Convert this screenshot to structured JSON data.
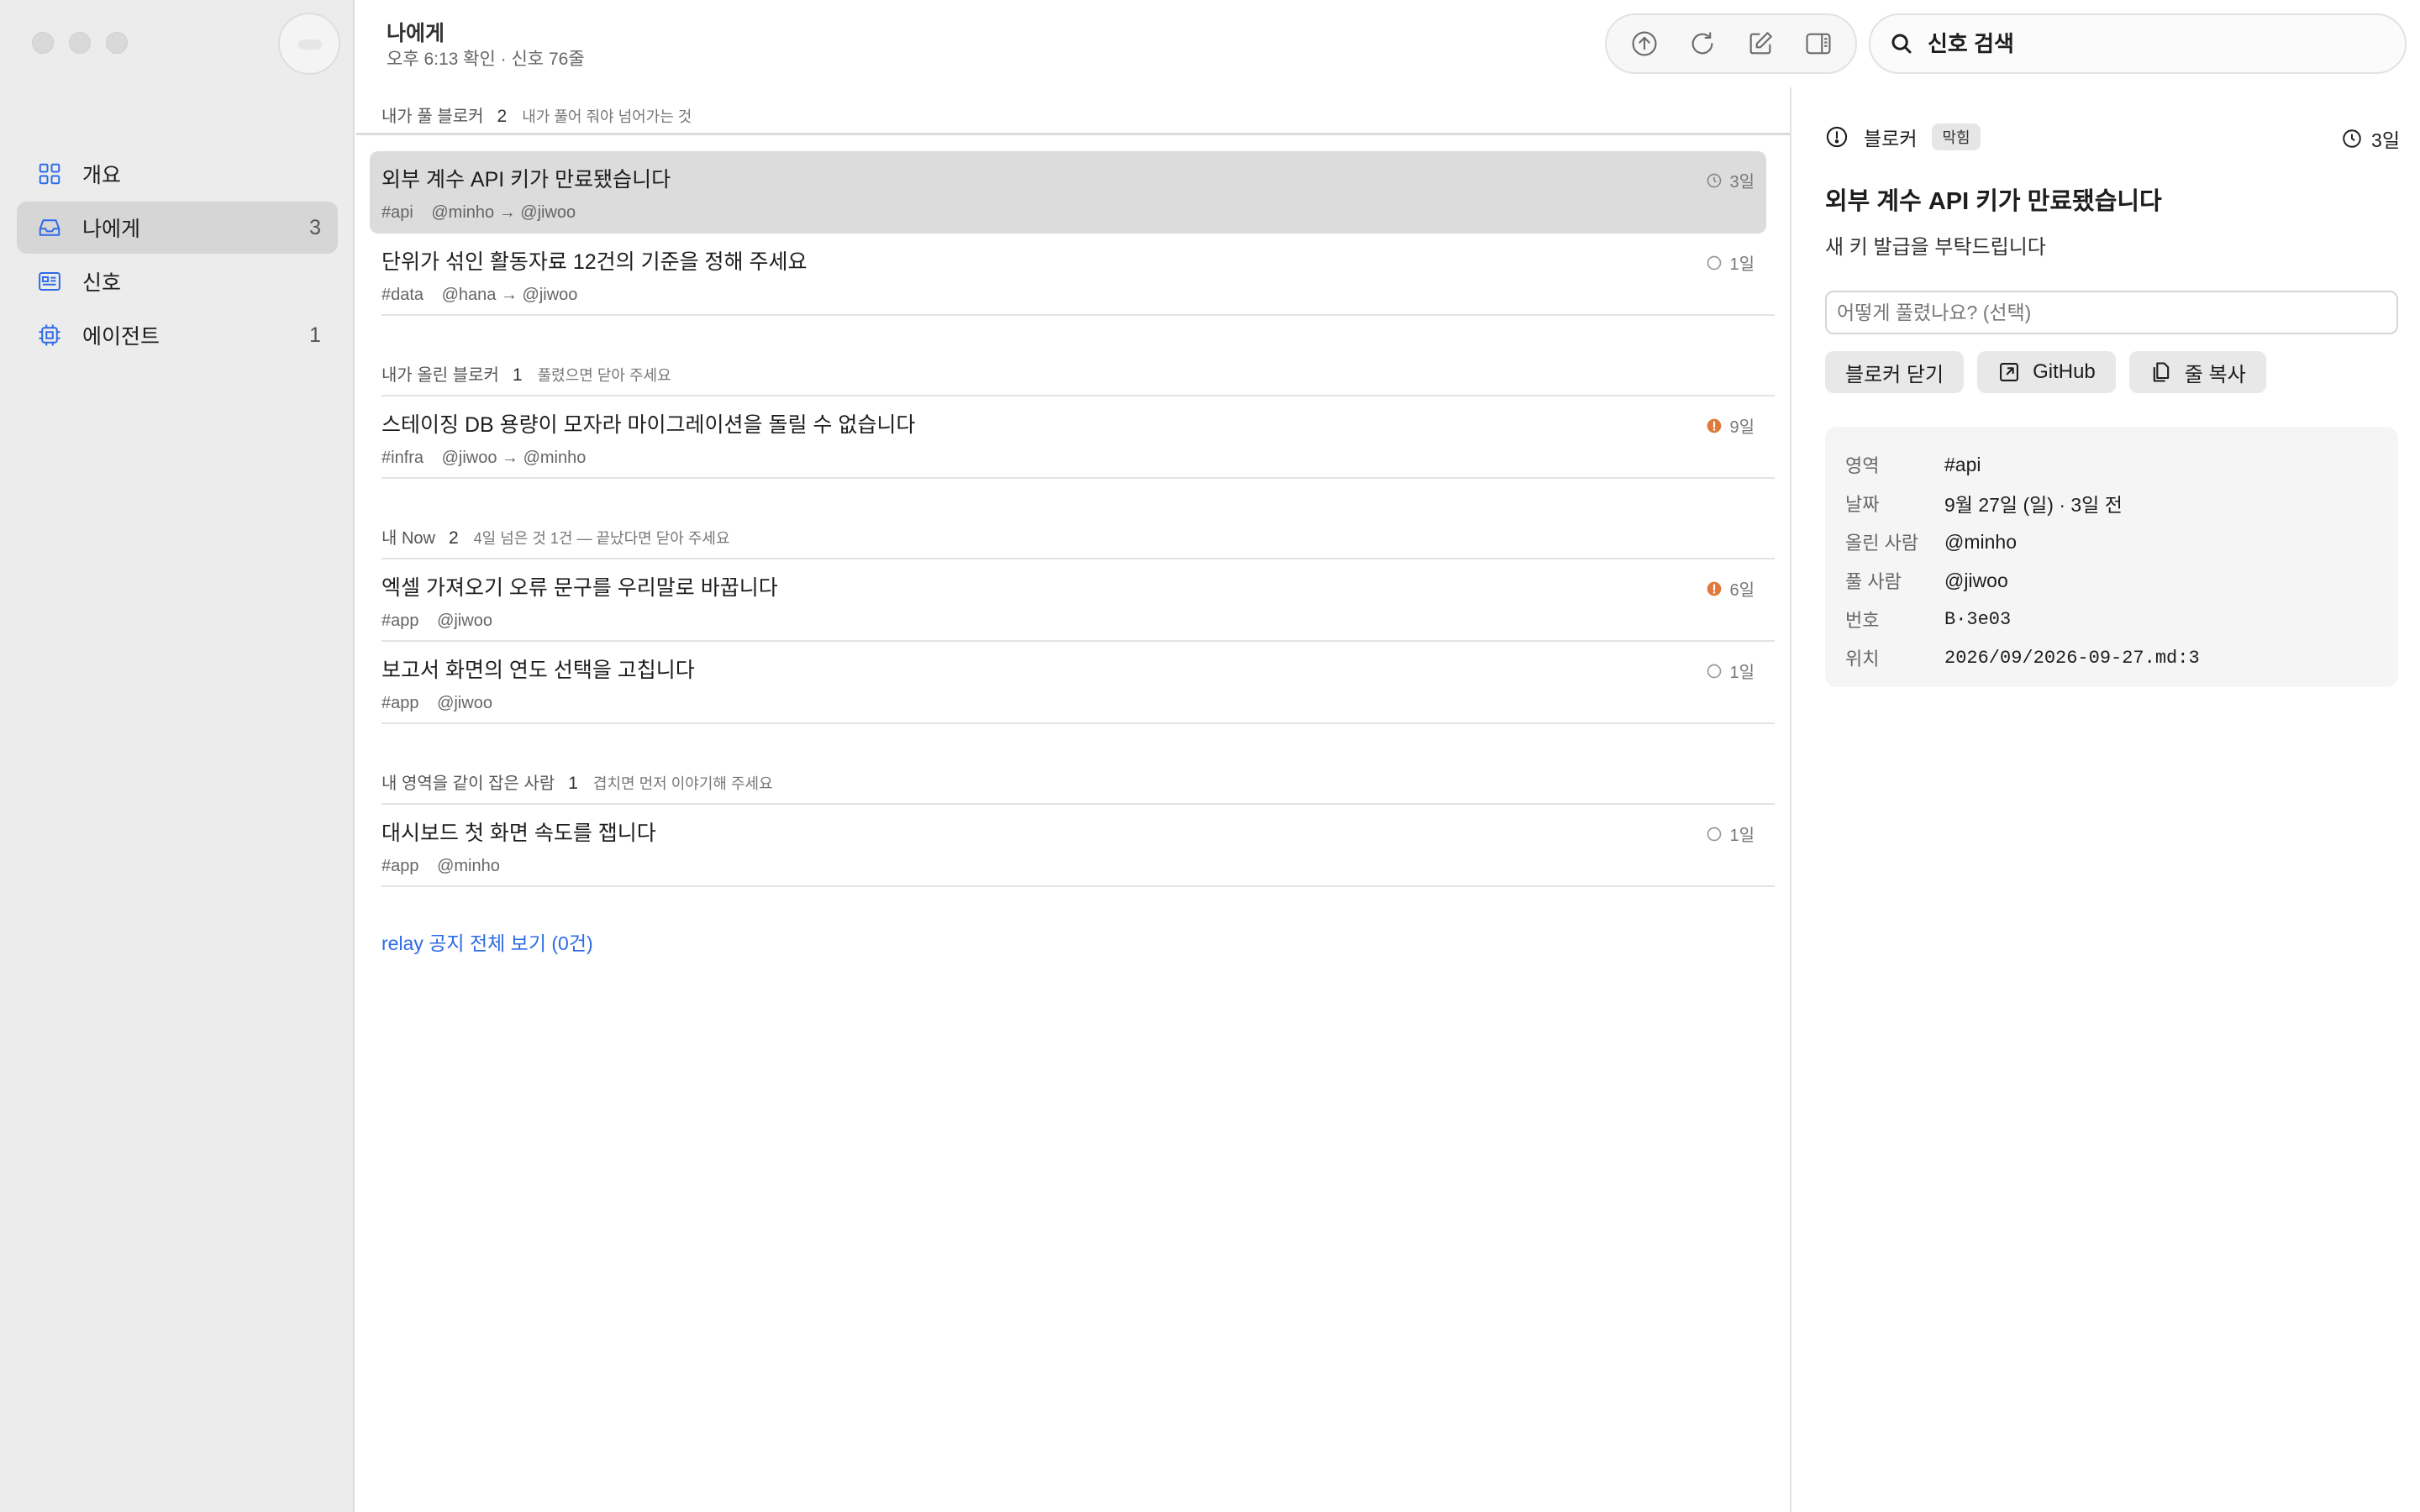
{
  "sidebar": {
    "items": [
      {
        "label": "개요",
        "count": "",
        "icon": "grid-icon",
        "active": false
      },
      {
        "label": "나에게",
        "count": "3",
        "icon": "inbox-icon",
        "active": true
      },
      {
        "label": "신호",
        "count": "",
        "icon": "news-icon",
        "active": false
      },
      {
        "label": "에이전트",
        "count": "1",
        "icon": "chip-icon",
        "active": false
      }
    ]
  },
  "header": {
    "title": "나에게",
    "subtitle": "오후 6:13 확인 · 신호 76줄",
    "toolbar": [
      "upload-icon",
      "refresh-icon",
      "compose-icon",
      "panel-toggle-icon"
    ]
  },
  "search": {
    "placeholder": "신호 검색",
    "value": ""
  },
  "list": {
    "sections": [
      {
        "title": "내가 풀 블로커",
        "count": "2",
        "note": "내가 풀어 줘야 넘어가는 것",
        "rows": [
          {
            "title": "외부 계수 API 키가 만료됐습니다",
            "tag": "#api",
            "people": "@minho → @jiwoo",
            "age": "3일",
            "status": "clock",
            "selected": true
          },
          {
            "title": "단위가 섞인 활동자료 12건의 기준을 정해 주세요",
            "tag": "#data",
            "people": "@hana → @jiwoo",
            "age": "1일",
            "status": "open",
            "selected": false
          }
        ]
      },
      {
        "title": "내가 올린 블로커",
        "count": "1",
        "note": "풀렸으면 닫아 주세요",
        "rows": [
          {
            "title": "스테이징 DB 용량이 모자라 마이그레이션을 돌릴 수 없습니다",
            "tag": "#infra",
            "people": "@jiwoo → @minho",
            "age": "9일",
            "status": "alert",
            "selected": false
          }
        ]
      },
      {
        "title": "내 Now",
        "count": "2",
        "note": "4일 넘은 것 1건 — 끝났다면 닫아 주세요",
        "rows": [
          {
            "title": "엑셀 가져오기 오류 문구를 우리말로 바꿉니다",
            "tag": "#app",
            "people": "@jiwoo",
            "age": "6일",
            "status": "alert",
            "selected": false
          },
          {
            "title": "보고서 화면의 연도 선택을 고칩니다",
            "tag": "#app",
            "people": "@jiwoo",
            "age": "1일",
            "status": "open",
            "selected": false
          }
        ]
      },
      {
        "title": "내 영역을 같이 잡은 사람",
        "count": "1",
        "note": "겹치면 먼저 이야기해 주세요",
        "rows": [
          {
            "title": "대시보드 첫 화면 속도를 잽니다",
            "tag": "#app",
            "people": "@minho",
            "age": "1일",
            "status": "open",
            "selected": false
          }
        ]
      }
    ],
    "relay_link": "relay 공지 전체 보기 (0건)"
  },
  "detail": {
    "kind": "블로커",
    "badge": "막힘",
    "age": "3일",
    "title": "외부 계수 API 키가 만료됐습니다",
    "description": "새 키 발급을 부탁드립니다",
    "resolve_placeholder": "어떻게 풀렸나요? (선택)",
    "actions": {
      "close": "블로커 닫기",
      "github": "GitHub",
      "copy": "줄 복사"
    },
    "info": [
      {
        "key": "영역",
        "value": "#api",
        "mono": false
      },
      {
        "key": "날짜",
        "value": "9월 27일 (일) · 3일 전",
        "mono": false
      },
      {
        "key": "올린 사람",
        "value": "@minho",
        "mono": false
      },
      {
        "key": "풀 사람",
        "value": "@jiwoo",
        "mono": false
      },
      {
        "key": "번호",
        "value": "B·3e03",
        "mono": true
      },
      {
        "key": "위치",
        "value": "2026/09/2026-09-27.md:3",
        "mono": true
      }
    ]
  },
  "colors": {
    "accent": "#2e6be6",
    "alert": "#e07a3c",
    "selected_row": "#dcdcdc",
    "sidebar_bg": "#ececec"
  }
}
